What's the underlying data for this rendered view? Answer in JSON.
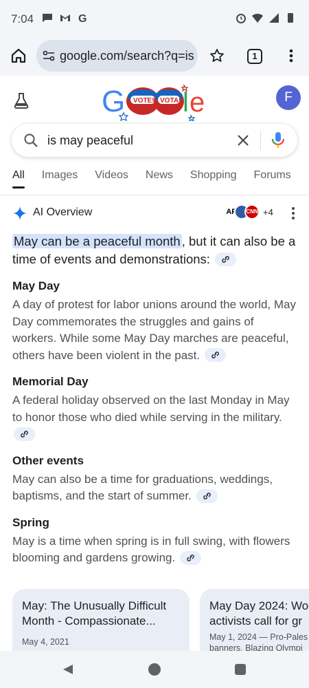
{
  "status_bar": {
    "time": "7:04",
    "left_icons": [
      "chat-bubble-icon",
      "gmail-icon",
      "google-g-icon"
    ],
    "right_icons": [
      "alarm-icon",
      "wifi-icon",
      "signal-icon",
      "battery-icon"
    ]
  },
  "browser": {
    "url": "google.com/search?q=is",
    "tab_count": "1"
  },
  "header": {
    "avatar_letter": "F",
    "doodle_texts": [
      "VOTE!",
      "VOTA!"
    ]
  },
  "search": {
    "query": "is may peaceful"
  },
  "tabs": [
    {
      "label": "All",
      "active": true
    },
    {
      "label": "Images",
      "active": false
    },
    {
      "label": "Videos",
      "active": false
    },
    {
      "label": "News",
      "active": false
    },
    {
      "label": "Shopping",
      "active": false
    },
    {
      "label": "Forums",
      "active": false
    }
  ],
  "ai_overview": {
    "title": "AI Overview",
    "sources": [
      "AP",
      "",
      "CNN"
    ],
    "more_sources": "+4",
    "lead_highlight": "May can be a peaceful month",
    "lead_rest": ", but it can also be a time of events and demonstrations:",
    "sections": [
      {
        "title": "May Day",
        "body": "A day of protest for labor unions around the world, May Day commemorates the struggles and gains of workers. While some May Day marches are peaceful, others have been violent in the past."
      },
      {
        "title": "Memorial Day",
        "body": "A federal holiday observed on the last Monday in May to honor those who died while serving in the military."
      },
      {
        "title": "Other events",
        "body": "May can also be a time for graduations, weddings, baptisms, and the start of summer."
      },
      {
        "title": "Spring",
        "body": "May is a time when spring is in full swing, with flowers blooming and gardens growing."
      }
    ]
  },
  "cards": [
    {
      "title": "May: The Unusually Difficult Month - Compassionate...",
      "date": "May 4, 2021"
    },
    {
      "title": "May Day 2024: Wo",
      "title2": "activists call for gr",
      "sub1": "May 1, 2024 — Pro-Pales",
      "sub2": "banners. Blazing Olympi"
    }
  ],
  "colors": {
    "accent_blue": "#1a73e8",
    "highlight": "#d3e3fd",
    "avatar": "#5464d2"
  }
}
